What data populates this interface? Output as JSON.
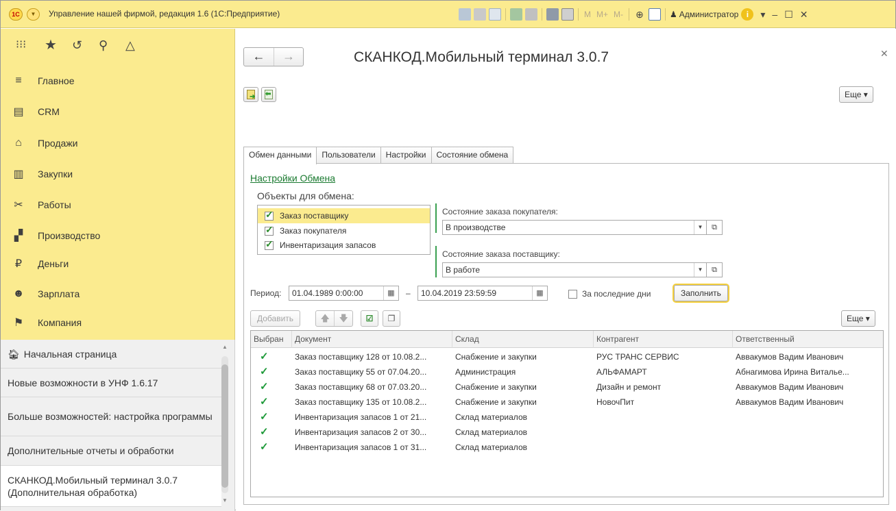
{
  "titlebar": {
    "title": "Управление нашей фирмой, редакция 1.6 (1С:Предприятие)",
    "logo_text": "1С",
    "m_labels": [
      "M",
      "M+",
      "M-"
    ],
    "user": "Администратор"
  },
  "sidebar": {
    "items": [
      {
        "icon": "≡",
        "label": "Главное"
      },
      {
        "icon": "▤",
        "label": "CRM"
      },
      {
        "icon": "⌂",
        "label": "Продажи"
      },
      {
        "icon": "▥",
        "label": "Закупки"
      },
      {
        "icon": "✂",
        "label": "Работы"
      },
      {
        "icon": "▞",
        "label": "Производство"
      },
      {
        "icon": "₽",
        "label": "Деньги"
      },
      {
        "icon": "☻",
        "label": "Зарплата"
      },
      {
        "icon": "⚑",
        "label": "Компания"
      }
    ],
    "favorites": [
      "Начальная страница",
      "Новые возможности в УНФ 1.6.17",
      "Больше возможностей: настройка программы",
      "Дополнительные отчеты и обработки",
      "СКАНКОД.Мобильный терминал 3.0.7 (Дополнительная обработка)"
    ]
  },
  "main": {
    "title": "СКАНКОД.Мобильный терминал 3.0.7",
    "more_label": "Еще ▾",
    "tabs": [
      "Обмен данными",
      "Пользователи",
      "Настройки",
      "Состояние обмена"
    ],
    "exchange_settings_link": "Настройки Обмена",
    "objects_label": "Объекты для обмена:",
    "objects": [
      {
        "label": "Заказ поставщику",
        "checked": true
      },
      {
        "label": "Заказ покупателя",
        "checked": true
      },
      {
        "label": "Инвентаризация запасов",
        "checked": true
      }
    ],
    "customer_order_state_label": "Состояние заказа покупателя:",
    "customer_order_state_value": "В производстве",
    "supplier_order_state_label": "Состояние заказа поставщику:",
    "supplier_order_state_value": "В работе",
    "period_label": "Период:",
    "period_from": "01.04.1989  0:00:00",
    "period_dash": "–",
    "period_to": "10.04.2019 23:59:59",
    "last_days_label": "За последние дни",
    "fill_button": "Заполнить",
    "add_button": "Добавить",
    "table_more": "Еще ▾",
    "table": {
      "columns": [
        "Выбран",
        "Документ",
        "Склад",
        "Контрагент",
        "Ответственный"
      ],
      "rows": [
        {
          "doc": "Заказ поставщику 128 от 10.08.2...",
          "store": "Снабжение и закупки",
          "partner": "РУС ТРАНС СЕРВИС",
          "resp": "Аввакумов Вадим Иванович"
        },
        {
          "doc": "Заказ поставщику 55 от 07.04.20...",
          "store": "Администрация",
          "partner": "АЛЬФАМАРТ",
          "resp": "Абнагимова Ирина Виталье..."
        },
        {
          "doc": "Заказ поставщику 68 от 07.03.20...",
          "store": "Снабжение и закупки",
          "partner": "Дизайн и ремонт",
          "resp": "Аввакумов Вадим Иванович"
        },
        {
          "doc": "Заказ поставщику 135 от 10.08.2...",
          "store": "Снабжение и закупки",
          "partner": "НовочПит",
          "resp": "Аввакумов Вадим Иванович"
        },
        {
          "doc": "Инвентаризация запасов 1 от 21...",
          "store": "Склад материалов",
          "partner": "",
          "resp": ""
        },
        {
          "doc": "Инвентаризация запасов 2 от 30...",
          "store": "Склад материалов",
          "partner": "",
          "resp": ""
        },
        {
          "doc": "Инвентаризация запасов 1 от 31...",
          "store": "Склад материалов",
          "partner": "",
          "resp": ""
        }
      ]
    }
  },
  "colors": {
    "accent_yellow": "#fbeb8f",
    "link_green": "#1a7a30",
    "check_green": "#1f9a3a"
  }
}
